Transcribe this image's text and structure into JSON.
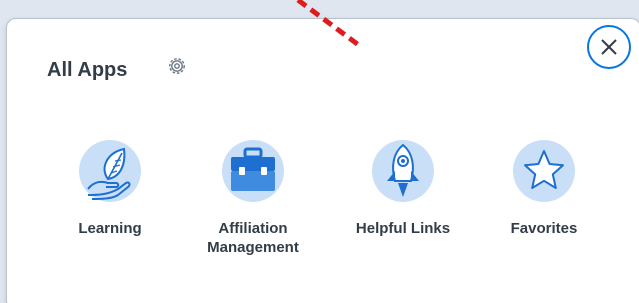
{
  "panel": {
    "title": "All Apps"
  },
  "apps": [
    {
      "label": "Learning",
      "icon": "leaf-hand-icon"
    },
    {
      "label": "Affiliation\nManagement",
      "label_line1": "Affiliation",
      "label_line2": "Management",
      "icon": "briefcase-icon"
    },
    {
      "label": "Helpful Links",
      "icon": "rocket-icon"
    },
    {
      "label": "Favorites",
      "icon": "star-icon"
    }
  ],
  "colors": {
    "accent": "#0875e1",
    "icon_bg": "#c9dff7",
    "icon_blue": "#1d6fd1",
    "annotation": "#e01b1b",
    "text": "#333d47"
  }
}
